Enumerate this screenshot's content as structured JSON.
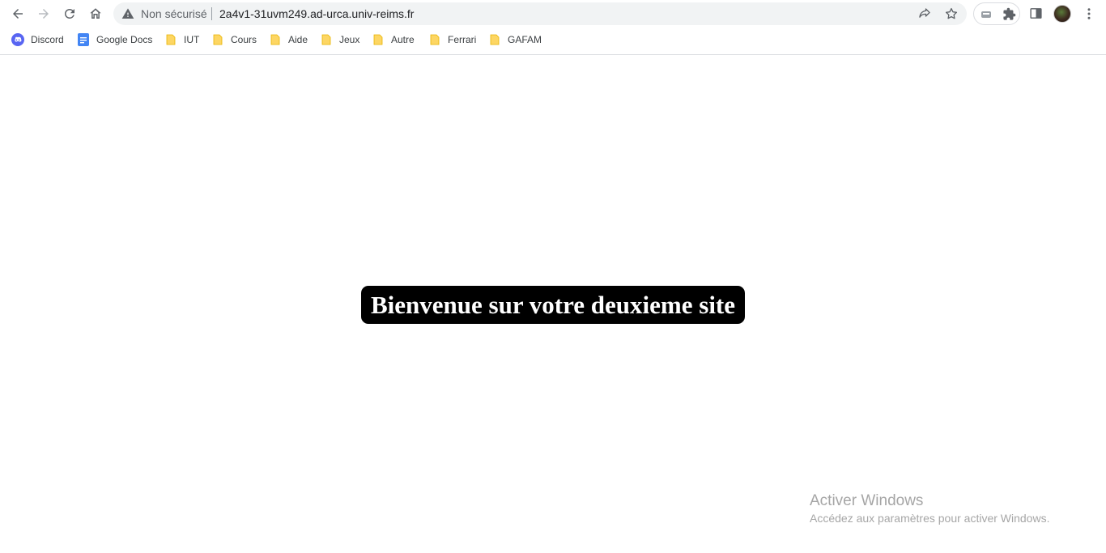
{
  "toolbar": {
    "back_icon": "arrow-left-icon",
    "forward_icon": "arrow-right-icon",
    "reload_icon": "reload-icon",
    "home_icon": "home-icon"
  },
  "omnibox": {
    "security_icon": "warning-triangle-icon",
    "security_text": "Non sécurisé",
    "url": "2a4v1-31uvm249.ad-urca.univ-reims.fr",
    "share_icon": "share-icon",
    "bookmark_icon": "star-icon"
  },
  "extensions": [
    "extension-icon",
    "puzzle-icon"
  ],
  "bookmarks": [
    {
      "label": "Discord",
      "icon": "discord-icon"
    },
    {
      "label": "Google Docs",
      "icon": "google-docs-icon"
    },
    {
      "label": "IUT",
      "icon": "folder-icon"
    },
    {
      "label": "Cours",
      "icon": "folder-icon"
    },
    {
      "label": "Aide",
      "icon": "folder-icon"
    },
    {
      "label": "Jeux",
      "icon": "folder-icon"
    },
    {
      "label": "Autre",
      "icon": "folder-icon"
    },
    {
      "label": "Ferrari",
      "icon": "folder-icon"
    },
    {
      "label": "GAFAM",
      "icon": "folder-icon"
    }
  ],
  "page": {
    "heading": "Bienvenue sur votre deuxieme site"
  },
  "watermark": {
    "title": "Activer Windows",
    "subtitle": "Accédez aux paramètres pour activer Windows."
  },
  "colors": {
    "folder": "#fdd663",
    "discord": "#5865f2",
    "docs": "#4285f4",
    "heading_bg": "#000000",
    "heading_text": "#ffffff"
  }
}
